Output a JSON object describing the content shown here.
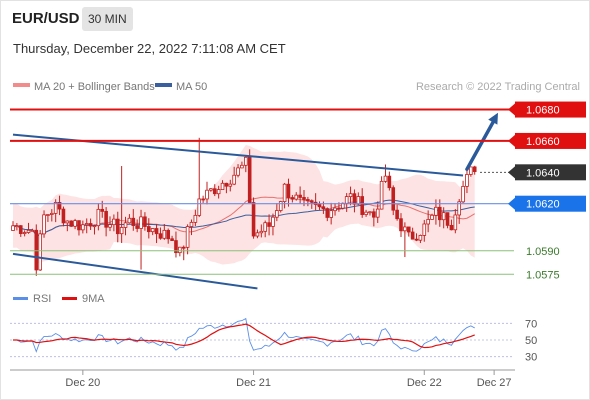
{
  "header": {
    "pair": "EUR/USD",
    "timeframe": "30 MIN",
    "datetime": "Thursday, December 22, 2022 7:11:08 AM CET"
  },
  "legend": {
    "ma20_bb": "MA 20 + Bollinger Bands",
    "ma50": "MA 50",
    "copyright": "Research © 2022 Trading Central"
  },
  "colors": {
    "resistance": "#e01010",
    "support_line": "#5a9a3a",
    "trend_channel": "#2a5a9a",
    "ma50": "#3a5f9f",
    "bollinger_fill": "#fde3e3",
    "ma20": "#e87070",
    "bull_candle": "#c02020",
    "bear_candle": "#c02020",
    "current_label": "#333333",
    "pivot_label": "#1a73e8",
    "rsi_line": "#5b8ee8",
    "rsi_ma": "#e01010",
    "arrow": "#2a5a9a"
  },
  "chart_data": [
    {
      "type": "candlestick",
      "instrument": "EUR/USD",
      "timeframe": "30 MIN",
      "x_ticks": [
        "Dec 20",
        "Dec 21",
        "Dec 22",
        "Dec 27"
      ],
      "ylim": [
        1.0565,
        1.0688
      ],
      "levels": [
        {
          "value": 1.068,
          "label": "1.0680",
          "kind": "resistance"
        },
        {
          "value": 1.066,
          "label": "1.0660",
          "kind": "resistance"
        },
        {
          "value": 1.064,
          "label": "1.0640",
          "kind": "current"
        },
        {
          "value": 1.062,
          "label": "1.0620",
          "kind": "pivot"
        },
        {
          "value": 1.059,
          "label": "1.0590",
          "kind": "support"
        },
        {
          "value": 1.0575,
          "label": "1.0575",
          "kind": "support"
        }
      ],
      "trendlines": [
        {
          "name": "channel upper",
          "from": {
            "bar": 0,
            "price": 1.0664
          },
          "to": {
            "bar": 116,
            "price": 1.0638
          }
        },
        {
          "name": "channel lower",
          "from": {
            "bar": 0,
            "price": 1.0588
          },
          "to": {
            "bar": 63,
            "price": 1.0566
          }
        }
      ],
      "projection": {
        "from": {
          "bar": 117,
          "price": 1.0642
        },
        "to": {
          "bar": 125,
          "price": 1.0678
        }
      },
      "series": [
        {
          "name": "MA 20",
          "kind": "overlay"
        },
        {
          "name": "MA 50",
          "kind": "overlay"
        }
      ]
    },
    {
      "type": "line",
      "title": "RSI",
      "legend": [
        "RSI",
        "9MA"
      ],
      "y_ticks": [
        70,
        50,
        30
      ],
      "ylim": [
        20,
        80
      ],
      "guides": [
        70,
        50,
        30
      ]
    }
  ]
}
